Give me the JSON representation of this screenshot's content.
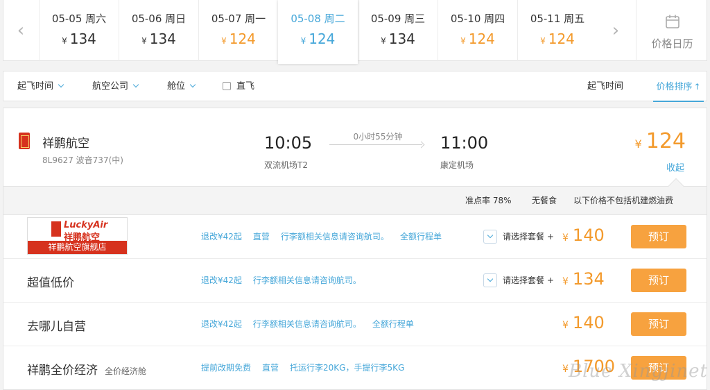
{
  "date_strip": {
    "prev_icon": "chevron-left-icon",
    "next_icon": "chevron-right-icon",
    "currency": "¥",
    "dates": [
      {
        "label": "05-05 周六",
        "price": "134",
        "low": false,
        "selected": false
      },
      {
        "label": "05-06 周日",
        "price": "134",
        "low": false,
        "selected": false
      },
      {
        "label": "05-07 周一",
        "price": "124",
        "low": true,
        "selected": false
      },
      {
        "label": "05-08 周二",
        "price": "124",
        "low": false,
        "selected": true
      },
      {
        "label": "05-09 周三",
        "price": "134",
        "low": false,
        "selected": false
      },
      {
        "label": "05-10 周四",
        "price": "124",
        "low": true,
        "selected": false
      },
      {
        "label": "05-11 周五",
        "price": "124",
        "low": true,
        "selected": false
      }
    ],
    "calendar_label": "价格日历",
    "calendar_icon": "calendar-icon"
  },
  "filters": {
    "departure_time": "起飞时间",
    "airline": "航空公司",
    "cabin": "舱位",
    "nonstop": "直飞",
    "sort_departure": "起飞时间",
    "sort_price": "价格排序"
  },
  "flight": {
    "airline": "祥鹏航空",
    "flight_no": "8L9627 波音737(中)",
    "dep_time": "10:05",
    "dep_airport": "双流机场T2",
    "duration": "0小时55分钟",
    "arr_time": "11:00",
    "arr_airport": "康定机场",
    "price": "124",
    "collapse": "收起",
    "on_time": "准点率 78%",
    "meal": "无餐食",
    "fee_note": "以下价格不包括机建燃油费"
  },
  "cabins": [
    {
      "store_logo": {
        "en": "LuckyAir",
        "cn": "祥鹏航空",
        "banner": "祥鹏航空旗舰店"
      },
      "name": "",
      "sub": "",
      "rules": [
        "退改¥42起",
        "直营",
        "行李额相关信息请咨询航司。",
        "全额行程单"
      ],
      "package": "请选择套餐 +",
      "price": "140",
      "book": "预订"
    },
    {
      "name": "超值低价",
      "sub": "",
      "rules": [
        "退改¥42起",
        "行李额相关信息请咨询航司。"
      ],
      "package": "请选择套餐 +",
      "price": "134",
      "book": "预订"
    },
    {
      "name": "去哪儿自营",
      "sub": "",
      "rules": [
        "退改¥42起",
        "行李额相关信息请咨询航司。",
        "全额行程单"
      ],
      "package": "",
      "price": "140",
      "book": "预订"
    },
    {
      "name": "祥鹏全价经济",
      "sub": "全价经济舱",
      "rules": [
        "提前改期免费",
        "直营",
        "托运行李20KG，手提行李5KG"
      ],
      "package": "",
      "price": "1700",
      "book": "预订"
    }
  ],
  "watermark": "Blue Xingjinet",
  "colors": {
    "accent": "#46a7d9",
    "price": "#f39a2c",
    "button": "#f7a23f",
    "brand_red": "#d6321e"
  }
}
